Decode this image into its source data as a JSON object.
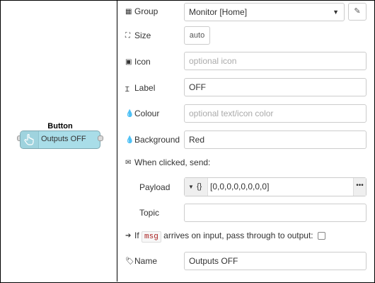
{
  "node": {
    "title": "Button",
    "label": "Outputs OFF"
  },
  "form": {
    "group": {
      "label": "Group",
      "icon": "table-icon",
      "value": "Monitor [Home]"
    },
    "size": {
      "label": "Size",
      "icon": "size-icon",
      "value": "auto"
    },
    "icon": {
      "label": "Icon",
      "icon": "picture-icon",
      "placeholder": "optional icon"
    },
    "label": {
      "label": "Label",
      "icon": "text-cursor-icon",
      "value": "OFF"
    },
    "colour": {
      "label": "Colour",
      "icon": "tint-icon",
      "placeholder": "optional text/icon color"
    },
    "background": {
      "label": "Background",
      "icon": "tint-icon",
      "value": "Red"
    },
    "when_clicked": {
      "label": "When clicked, send:",
      "icon": "envelope-icon"
    },
    "payload": {
      "label": "Payload",
      "type_symbol": "{}",
      "value": "[0,0,0,0,0,0,0,0]"
    },
    "topic": {
      "label": "Topic",
      "value": ""
    },
    "passthrough": {
      "prefix": "If",
      "code": "msg",
      "suffix": "arrives on input, pass through to output:",
      "checked": false
    },
    "name": {
      "label": "Name",
      "icon": "tag-icon",
      "value": "Outputs OFF"
    }
  }
}
